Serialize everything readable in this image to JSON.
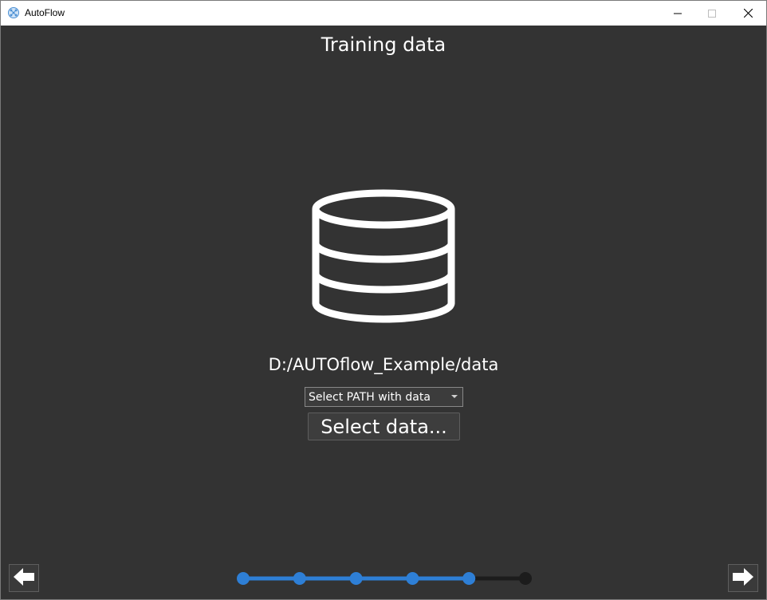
{
  "window": {
    "title": "AutoFlow",
    "minimize_icon": "minimize-icon",
    "maximize_icon": "maximize-icon",
    "close_icon": "close-icon"
  },
  "page": {
    "title": "Training data",
    "icon": "database-icon",
    "path": "D:/AUTOflow_Example/data"
  },
  "path_select": {
    "selected": "Select PATH with data"
  },
  "actions": {
    "select_data_label": "Select data..."
  },
  "navigation": {
    "back_icon": "arrow-left-icon",
    "next_icon": "arrow-right-icon"
  },
  "progress": {
    "total_steps": 6,
    "completed_steps": 5,
    "active_color": "#2e7fd6",
    "inactive_color": "#1c1c1c"
  },
  "colors": {
    "background": "#333333",
    "text": "#ffffff",
    "titlebar": "#ffffff"
  }
}
